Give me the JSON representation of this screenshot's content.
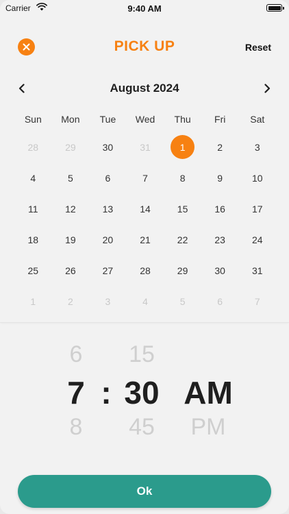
{
  "status_bar": {
    "carrier": "Carrier",
    "time": "9:40 AM"
  },
  "header": {
    "title": "PICK UP",
    "reset_label": "Reset"
  },
  "calendar": {
    "month_title": "August 2024",
    "weekdays": [
      "Sun",
      "Mon",
      "Tue",
      "Wed",
      "Thu",
      "Fri",
      "Sat"
    ],
    "weeks": [
      [
        {
          "d": "28",
          "muted": true
        },
        {
          "d": "29",
          "muted": true
        },
        {
          "d": "30",
          "muted": false
        },
        {
          "d": "31",
          "muted": true
        },
        {
          "d": "1",
          "muted": false,
          "selected": true
        },
        {
          "d": "2",
          "muted": false
        },
        {
          "d": "3",
          "muted": false
        }
      ],
      [
        {
          "d": "4"
        },
        {
          "d": "5"
        },
        {
          "d": "6"
        },
        {
          "d": "7"
        },
        {
          "d": "8"
        },
        {
          "d": "9"
        },
        {
          "d": "10"
        }
      ],
      [
        {
          "d": "11"
        },
        {
          "d": "12"
        },
        {
          "d": "13"
        },
        {
          "d": "14"
        },
        {
          "d": "15"
        },
        {
          "d": "16"
        },
        {
          "d": "17"
        }
      ],
      [
        {
          "d": "18"
        },
        {
          "d": "19"
        },
        {
          "d": "20"
        },
        {
          "d": "21"
        },
        {
          "d": "22"
        },
        {
          "d": "23"
        },
        {
          "d": "24"
        }
      ],
      [
        {
          "d": "25"
        },
        {
          "d": "26"
        },
        {
          "d": "27"
        },
        {
          "d": "28"
        },
        {
          "d": "29"
        },
        {
          "d": "30"
        },
        {
          "d": "31"
        }
      ],
      [
        {
          "d": "1",
          "muted": true
        },
        {
          "d": "2",
          "muted": true
        },
        {
          "d": "3",
          "muted": true
        },
        {
          "d": "4",
          "muted": true
        },
        {
          "d": "5",
          "muted": true
        },
        {
          "d": "6",
          "muted": true
        },
        {
          "d": "7",
          "muted": true
        }
      ]
    ]
  },
  "time_picker": {
    "hour_prev": "6",
    "hour": "7",
    "hour_next": "8",
    "separator": ":",
    "minute_prev": "15",
    "minute": "30",
    "minute_next": "45",
    "period": "AM",
    "period_next": "PM"
  },
  "ok_label": "Ok",
  "colors": {
    "accent": "#f78112",
    "primary": "#2b9b8c"
  }
}
